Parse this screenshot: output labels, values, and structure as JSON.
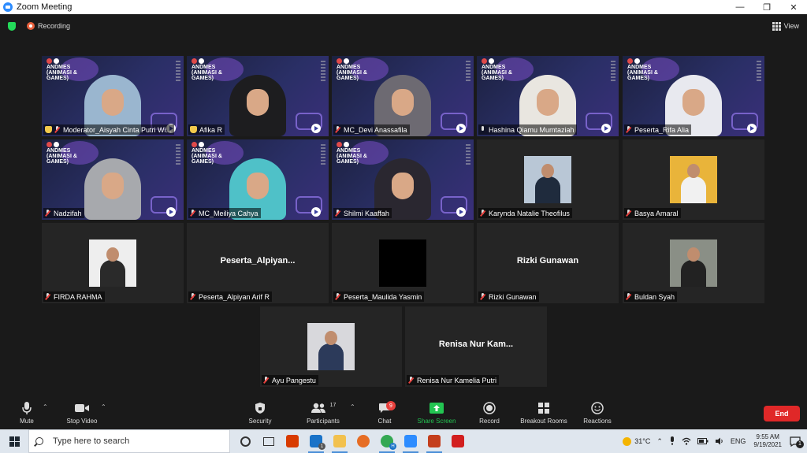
{
  "window": {
    "title": "Zoom Meeting",
    "controls": [
      "—",
      "❐",
      "✕"
    ]
  },
  "meeting": {
    "recording_label": "Recording",
    "view_label": "View",
    "brand_text": "ANDMES\n(ANIMASI &\nGAMES)",
    "participants": [
      {
        "name": "Moderator_Aisyah Cinta Putri Wi...",
        "kind": "video",
        "hijab": "#9ab6cf",
        "hand": true,
        "mic": "muted"
      },
      {
        "name": "Afika R",
        "kind": "video",
        "hijab": "#1d1d1f",
        "hand": true,
        "mic": "none"
      },
      {
        "name": "MC_Devi Anassafila",
        "kind": "video",
        "hijab": "#6d6a72",
        "hand": false,
        "mic": "muted"
      },
      {
        "name": "Hashina Qiamu Mumtaziah",
        "kind": "video",
        "hijab": "#e9e6e0",
        "hand": false,
        "mic": "on",
        "active": true
      },
      {
        "name": "Peserta_Rifa Alia",
        "kind": "video",
        "hijab": "#e8e9ef",
        "hand": false,
        "mic": "muted"
      },
      {
        "name": "Nadzifah",
        "kind": "video",
        "hijab": "#a7a9ad",
        "hand": false,
        "mic": "muted"
      },
      {
        "name": "MC_Meiliya Cahya",
        "kind": "video",
        "hijab": "#4fc1c8",
        "hand": false,
        "mic": "muted"
      },
      {
        "name": "Shilmi Kaaffah",
        "kind": "video",
        "hijab": "#2a2730",
        "hand": false,
        "mic": "muted"
      },
      {
        "name": "Karynda Natalie Theofilus",
        "kind": "photo",
        "photo_bg": "#b9c7d6",
        "body": "#1f2b3d",
        "mic": "muted"
      },
      {
        "name": "Basya Amaral",
        "kind": "photo",
        "photo_bg": "#e9b43a",
        "body": "#f1f1f1",
        "mic": "muted"
      },
      {
        "name": "FIRDA RAHMA",
        "kind": "photo",
        "photo_bg": "#eeeeee",
        "body": "#2a2a2a",
        "mic": "muted"
      },
      {
        "name": "Peserta_Alpiyan Arif R",
        "kind": "name",
        "big": "Peserta_Alpiyan...",
        "mic": "muted"
      },
      {
        "name": "Peserta_Maulida Yasmin",
        "kind": "photo",
        "photo_bg": "#000000",
        "body": "#000000",
        "mic": "muted"
      },
      {
        "name": "Rizki Gunawan",
        "kind": "name",
        "big": "Rizki Gunawan",
        "mic": "muted"
      },
      {
        "name": "Buldan Syah",
        "kind": "photo",
        "photo_bg": "#8a8f86",
        "body": "#222222",
        "mic": "muted"
      },
      {
        "name": "Ayu Pangestu",
        "kind": "photo",
        "photo_bg": "#d8d8dc",
        "body": "#2c3a5a",
        "mic": "muted"
      },
      {
        "name": "Renisa Nur Kamelia Putri",
        "kind": "name",
        "big": "Renisa Nur Kam...",
        "mic": "muted"
      }
    ]
  },
  "toolbar": {
    "mute": "Mute",
    "stop_video": "Stop Video",
    "security": "Security",
    "participants": "Participants",
    "participants_count": "17",
    "chat": "Chat",
    "chat_badge": "9",
    "share_screen": "Share Screen",
    "record": "Record",
    "breakout_rooms": "Breakout Rooms",
    "reactions": "Reactions",
    "end": "End",
    "colors": {
      "share": "#23c552",
      "end": "#e02828"
    }
  },
  "taskbar": {
    "search_placeholder": "Type here to search",
    "weather": "31°C",
    "language": "ENG",
    "time": "9:55 AM",
    "date": "9/19/2021",
    "notification_count": "1",
    "mail_badge": "1",
    "chrome_badge": "H",
    "apps": [
      {
        "name": "cortana-icon",
        "color": "#333333"
      },
      {
        "name": "task-view-icon",
        "color": "#333333"
      },
      {
        "name": "office-icon",
        "color": "#d83b01"
      },
      {
        "name": "mail-icon",
        "color": "#1a73c8"
      },
      {
        "name": "file-explorer-icon",
        "color": "#f2c14e"
      },
      {
        "name": "firefox-icon",
        "color": "#e66d24"
      },
      {
        "name": "chrome-icon",
        "color": "#34a853"
      },
      {
        "name": "zoom-icon",
        "color": "#2d8cff"
      },
      {
        "name": "powerpoint-icon",
        "color": "#c43e1c"
      },
      {
        "name": "acrobat-icon",
        "color": "#d21f1f"
      }
    ]
  }
}
